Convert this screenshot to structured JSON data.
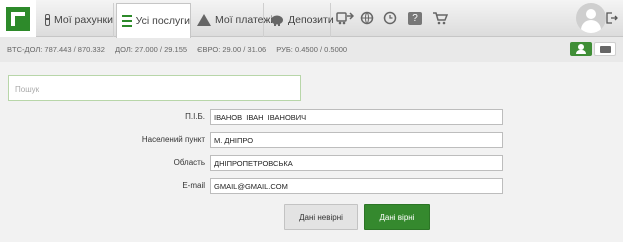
{
  "nav": {
    "tabs": [
      {
        "label": "Мої рахунки",
        "icon": "card-icon"
      },
      {
        "label": "Усі послуги",
        "icon": "list-icon",
        "active": true
      },
      {
        "label": "Мої платежі",
        "icon": "house-icon"
      },
      {
        "label": "Депозити",
        "icon": "piggy-bank-icon"
      }
    ],
    "toolbar_icons": [
      "transport-icon",
      "globe-icon",
      "clock-icon",
      "help-icon",
      "cart-icon"
    ],
    "help_glyph": "?"
  },
  "rates": {
    "btc": "BTC-ДОЛ: 787.443 / 870.332",
    "usd": "ДОЛ: 27.000 / 29.155",
    "eur": "ЄВРО: 29.00 / 31.06",
    "rub": "РУБ: 0.4500 / 0.5000"
  },
  "search": {
    "placeholder": "Пошук"
  },
  "form": {
    "fields": [
      {
        "label": "П.І.Б.",
        "value": "ІВАНОВ  ІВАН  ІВАНОВИЧ"
      },
      {
        "label": "Населений пункт",
        "value": "М. ДНІПРО"
      },
      {
        "label": "Область",
        "value": "ДНІПРОПЕТРОВСЬКА"
      },
      {
        "label": "E-mail",
        "value": "GMAIL@GMAIL.COM"
      }
    ],
    "reject_label": "Дані невірні",
    "confirm_label": "Дані вірні"
  },
  "colors": {
    "accent": "#35892e",
    "brand": "#2d8a2a"
  }
}
